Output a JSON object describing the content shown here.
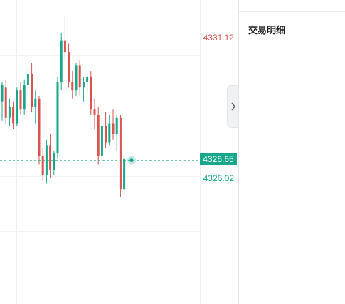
{
  "chart": {
    "high_price": "4331.12",
    "current_price": "4326.65",
    "low_price": "4326.02",
    "colors": {
      "up": "#17a88b",
      "down": "#d9534f",
      "current_line": "#17a88b",
      "grid": "#eeeeee"
    },
    "candles": [
      {
        "o": 4328.8,
        "h": 4329.5,
        "l": 4328.1,
        "c": 4329.4
      },
      {
        "o": 4329.3,
        "h": 4329.6,
        "l": 4328.0,
        "c": 4328.2
      },
      {
        "o": 4328.2,
        "h": 4328.9,
        "l": 4327.9,
        "c": 4328.6
      },
      {
        "o": 4328.6,
        "h": 4328.8,
        "l": 4327.8,
        "c": 4328.0
      },
      {
        "o": 4328.0,
        "h": 4329.3,
        "l": 4327.9,
        "c": 4329.2
      },
      {
        "o": 4329.2,
        "h": 4329.5,
        "l": 4328.3,
        "c": 4328.5
      },
      {
        "o": 4328.5,
        "h": 4329.6,
        "l": 4328.3,
        "c": 4329.4
      },
      {
        "o": 4329.4,
        "h": 4330.0,
        "l": 4329.0,
        "c": 4329.8
      },
      {
        "o": 4329.8,
        "h": 4330.2,
        "l": 4328.4,
        "c": 4328.6
      },
      {
        "o": 4328.6,
        "h": 4329.2,
        "l": 4328.0,
        "c": 4328.9
      },
      {
        "o": 4328.9,
        "h": 4329.0,
        "l": 4326.5,
        "c": 4326.8
      },
      {
        "o": 4326.8,
        "h": 4327.1,
        "l": 4325.9,
        "c": 4326.1
      },
      {
        "o": 4326.1,
        "h": 4327.4,
        "l": 4325.8,
        "c": 4327.2
      },
      {
        "o": 4327.2,
        "h": 4327.6,
        "l": 4326.0,
        "c": 4326.3
      },
      {
        "o": 4326.3,
        "h": 4327.0,
        "l": 4326.1,
        "c": 4326.9
      },
      {
        "o": 4326.9,
        "h": 4329.7,
        "l": 4326.7,
        "c": 4329.5
      },
      {
        "o": 4329.5,
        "h": 4331.3,
        "l": 4329.2,
        "c": 4331.0
      },
      {
        "o": 4331.0,
        "h": 4331.9,
        "l": 4330.3,
        "c": 4330.6
      },
      {
        "o": 4330.6,
        "h": 4330.9,
        "l": 4329.3,
        "c": 4329.5
      },
      {
        "o": 4329.5,
        "h": 4329.9,
        "l": 4328.9,
        "c": 4329.2
      },
      {
        "o": 4329.2,
        "h": 4330.2,
        "l": 4329.0,
        "c": 4330.1
      },
      {
        "o": 4330.1,
        "h": 4330.3,
        "l": 4329.0,
        "c": 4329.3
      },
      {
        "o": 4329.3,
        "h": 4329.7,
        "l": 4328.8,
        "c": 4329.5
      },
      {
        "o": 4329.5,
        "h": 4329.8,
        "l": 4329.1,
        "c": 4329.7
      },
      {
        "o": 4329.7,
        "h": 4329.9,
        "l": 4328.3,
        "c": 4328.5
      },
      {
        "o": 4328.5,
        "h": 4328.9,
        "l": 4327.8,
        "c": 4328.3
      },
      {
        "o": 4328.3,
        "h": 4328.6,
        "l": 4326.5,
        "c": 4326.8
      },
      {
        "o": 4326.8,
        "h": 4328.1,
        "l": 4326.6,
        "c": 4327.9
      },
      {
        "o": 4327.9,
        "h": 4328.4,
        "l": 4327.1,
        "c": 4327.3
      },
      {
        "o": 4327.3,
        "h": 4328.3,
        "l": 4327.2,
        "c": 4328.0
      },
      {
        "o": 4328.0,
        "h": 4328.5,
        "l": 4327.4,
        "c": 4327.6
      },
      {
        "o": 4327.6,
        "h": 4328.3,
        "l": 4327.0,
        "c": 4328.2
      },
      {
        "o": 4328.2,
        "h": 4328.3,
        "l": 4325.3,
        "c": 4325.6
      },
      {
        "o": 4325.6,
        "h": 4326.8,
        "l": 4325.4,
        "c": 4326.7
      }
    ]
  },
  "panel": {
    "title": "交易明细"
  }
}
